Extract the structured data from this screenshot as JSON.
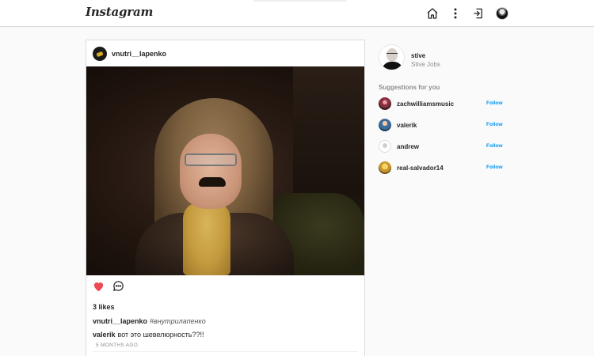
{
  "header": {
    "logo": "Instagram"
  },
  "post": {
    "username": "vnutri__lapenko",
    "likes": "3 likes",
    "caption_user": "vnutri__lapenko",
    "caption_tag": "#внутрилапенко",
    "comment_user": "valerik",
    "comment_text": "вот это шевелюрность??!!",
    "time_ago": "5 MONTHS AGO"
  },
  "me": {
    "username": "stive",
    "full_name": "Stive Jobs"
  },
  "suggestions": {
    "title": "Suggestions for you",
    "items": [
      {
        "username": "zachwilliamsmusic",
        "action": "Follow"
      },
      {
        "username": "valerik",
        "action": "Follow"
      },
      {
        "username": "andrew",
        "action": "Follow"
      },
      {
        "username": "real-salvador14",
        "action": "Follow"
      }
    ]
  },
  "colors": {
    "accent": "#0095f6",
    "like": "#ed4956",
    "border": "#dbdbdb",
    "background": "#fafafa"
  },
  "icons": [
    "home-icon",
    "more-icon",
    "logout-icon",
    "heart-icon",
    "comment-icon"
  ]
}
